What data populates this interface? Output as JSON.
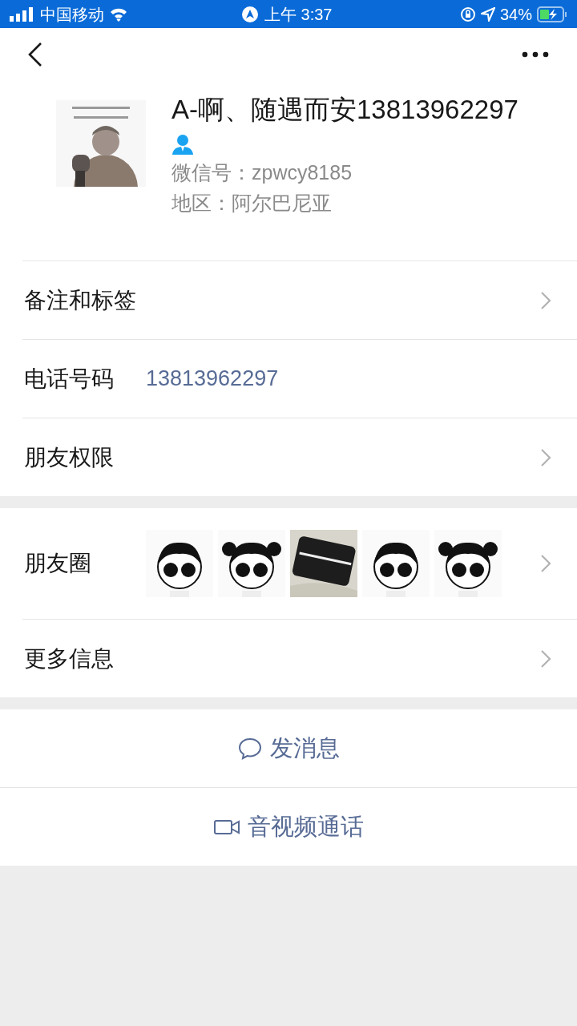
{
  "status_bar": {
    "carrier": "中国移动",
    "time": "上午 3:37",
    "battery": "34%"
  },
  "profile": {
    "name": "A-啊、随遇而安13813962297",
    "wechat_id": "微信号：zpwcy8185",
    "region": "地区：阿尔巴尼亚"
  },
  "groups": [
    [
      {
        "kind": "link",
        "label": "备注和标签"
      },
      {
        "kind": "value",
        "label": "电话号码",
        "value": "13813962297"
      },
      {
        "kind": "link",
        "label": "朋友权限"
      }
    ],
    [
      {
        "kind": "moments",
        "label": "朋友圈"
      },
      {
        "kind": "link",
        "label": "更多信息"
      }
    ]
  ],
  "actions": [
    {
      "kind": "message",
      "label": "发消息"
    },
    {
      "kind": "call",
      "label": "音视频通话"
    }
  ]
}
